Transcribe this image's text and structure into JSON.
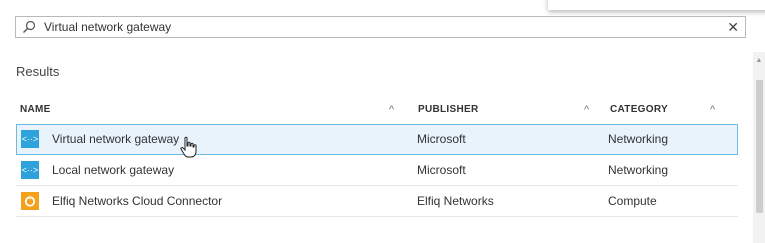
{
  "search": {
    "value": "Virtual network gateway",
    "icon": "search-icon",
    "clear_label": "✕"
  },
  "results": {
    "title": "Results",
    "columns": [
      {
        "label": "NAME",
        "sort_icon": "chevron-up-icon"
      },
      {
        "label": "PUBLISHER",
        "sort_icon": "chevron-up-icon"
      },
      {
        "label": "CATEGORY",
        "sort_icon": "chevron-up-icon"
      }
    ],
    "rows": [
      {
        "icon": "virtual-network-gateway-icon",
        "icon_glyph": "<··>",
        "icon_color": "#2ea2da",
        "name": "Virtual network gateway",
        "publisher": "Microsoft",
        "category": "Networking",
        "selected": true
      },
      {
        "icon": "local-network-gateway-icon",
        "icon_glyph": "<··>",
        "icon_color": "#2ea2da",
        "name": "Local network gateway",
        "publisher": "Microsoft",
        "category": "Networking",
        "selected": false
      },
      {
        "icon": "elfiq-connector-icon",
        "icon_glyph": "",
        "icon_color": "#f4a11d",
        "name": "Elfiq Networks Cloud Connector",
        "publisher": "Elfiq Networks",
        "category": "Compute",
        "selected": false
      }
    ]
  },
  "colors": {
    "selection_bg": "#e8f3fb",
    "selection_border": "#6fb9e6",
    "accent_blue": "#2ea2da",
    "accent_orange": "#f4a11d"
  }
}
